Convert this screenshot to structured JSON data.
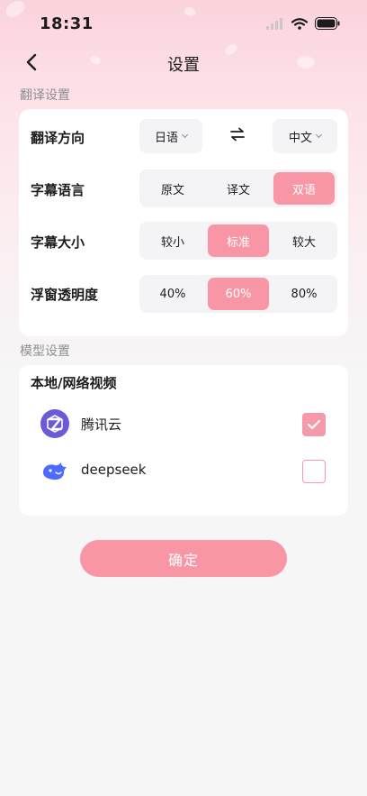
{
  "status_bar": {
    "time": "18:31"
  },
  "nav": {
    "title": "设置"
  },
  "translation_section": {
    "label": "翻译设置",
    "direction": {
      "label": "翻译方向",
      "source": "日语",
      "target": "中文"
    },
    "subtitle_language": {
      "label": "字幕语言",
      "options": [
        "原文",
        "译文",
        "双语"
      ],
      "selected": "双语"
    },
    "subtitle_size": {
      "label": "字幕大小",
      "options": [
        "较小",
        "标准",
        "较大"
      ],
      "selected": "标准"
    },
    "window_opacity": {
      "label": "浮窗透明度",
      "options": [
        "40%",
        "60%",
        "80%"
      ],
      "selected": "60%"
    }
  },
  "model_section": {
    "label": "模型设置",
    "group_title": "本地/网络视频",
    "models": [
      {
        "name": "腾讯云",
        "checked": true,
        "icon": "tencent-cloud-logo"
      },
      {
        "name": "deepseek",
        "checked": false,
        "icon": "deepseek-whale-logo"
      }
    ]
  },
  "confirm_label": "确定",
  "colors": {
    "accent": "#f996a6",
    "checkbox": "#f59aaa",
    "tencent": "#6a5bd6",
    "deepseek": "#4d6bfe"
  }
}
